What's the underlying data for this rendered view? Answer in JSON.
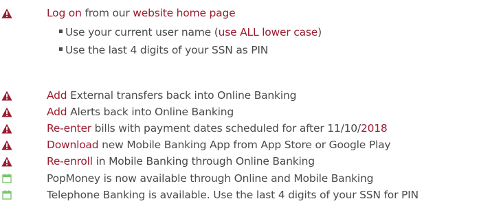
{
  "intro": {
    "icon": "warning-icon",
    "action": "Log on",
    "middle": " from our ",
    "link": "website home page",
    "bullets": [
      {
        "before": "Use your current user name (",
        "em": "use ALL lower case",
        "after": ")"
      },
      {
        "before": "Use the last 4 digits of your SSN as PIN",
        "em": "",
        "after": ""
      }
    ]
  },
  "tasks": [
    {
      "icon": "warning-icon",
      "action": "Add",
      "rest": " External transfers back into Online Banking",
      "em_tail": ""
    },
    {
      "icon": "warning-icon",
      "action": "Add",
      "rest": " Alerts back into Online Banking",
      "em_tail": ""
    },
    {
      "icon": "warning-icon",
      "action": "Re-enter",
      "rest": " bills with payment dates scheduled for after 11/10/",
      "em_tail": "2018"
    },
    {
      "icon": "warning-icon",
      "action": "Download",
      "rest": " new Mobile Banking App from App Store or Google Play",
      "em_tail": ""
    },
    {
      "icon": "warning-icon",
      "action": "Re-enroll",
      "rest": " in Mobile Banking through Online Banking",
      "em_tail": ""
    }
  ],
  "notes": [
    {
      "icon": "calendar-icon",
      "text": "PopMoney is now available through Online and Mobile Banking"
    },
    {
      "icon": "calendar-icon",
      "text": "Telephone Banking is available. Use the last 4 digits of your SSN for PIN"
    }
  ],
  "colors": {
    "accent": "#9b1c2e",
    "text": "#4a4a4a",
    "calendar": "#7cc46b"
  }
}
